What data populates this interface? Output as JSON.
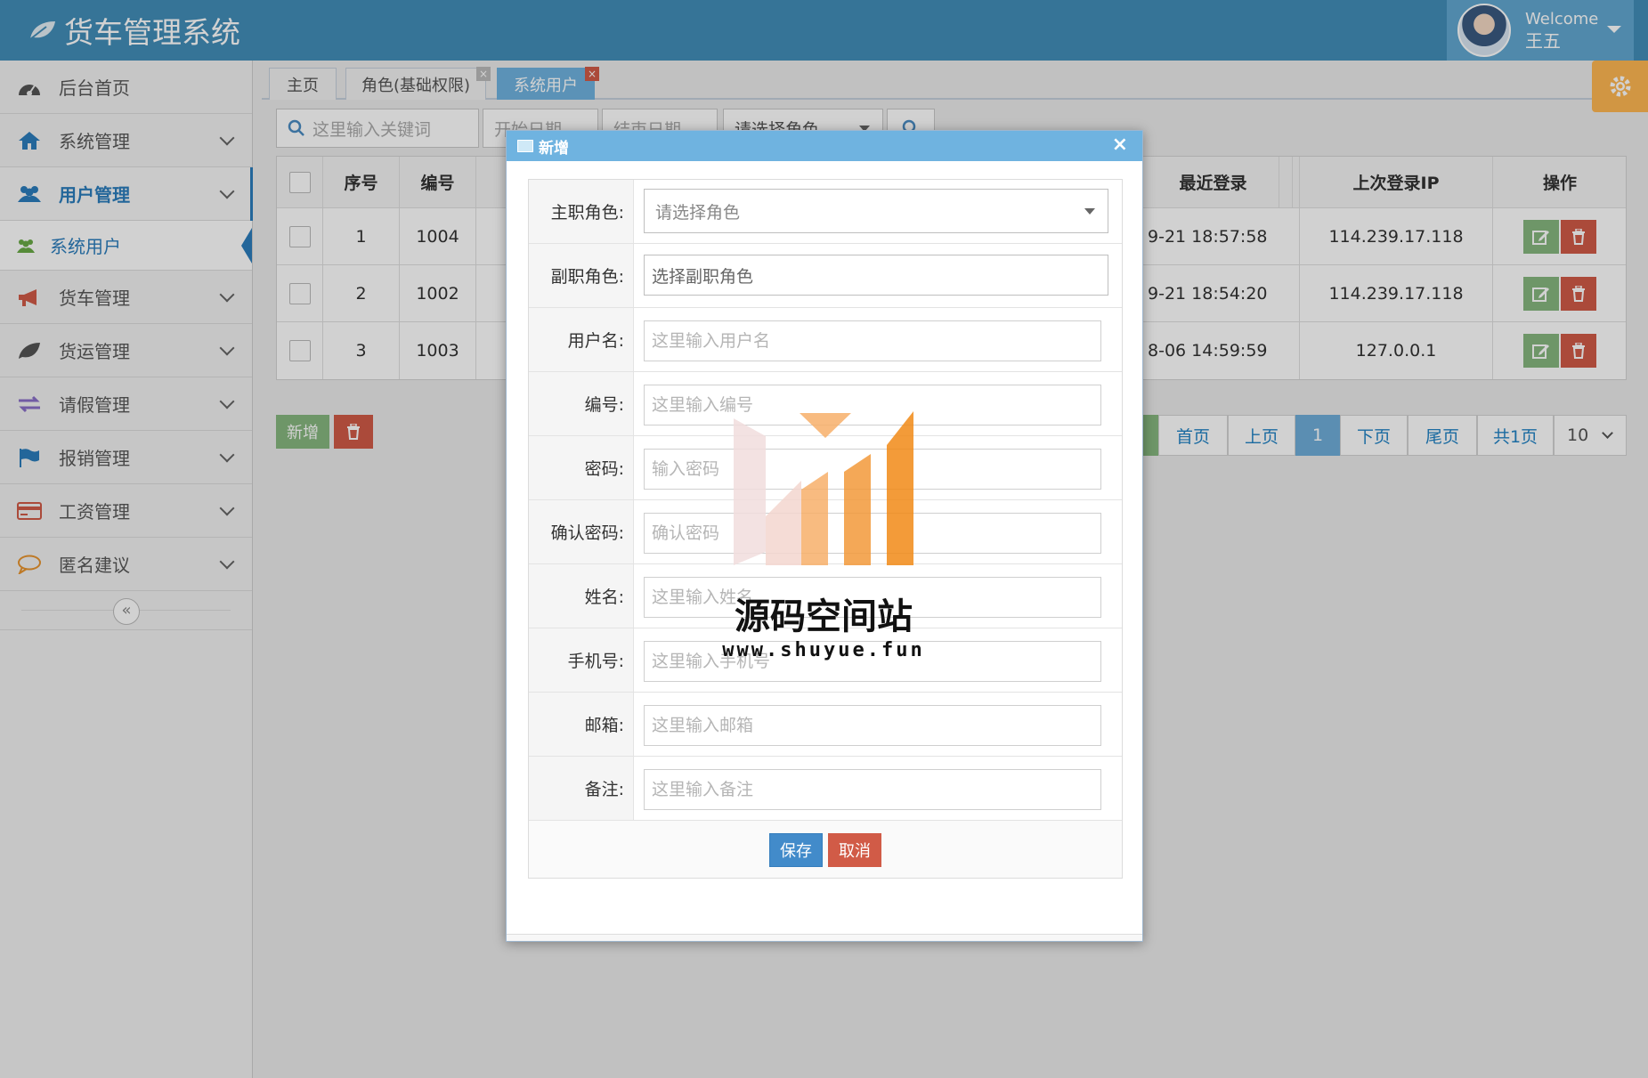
{
  "app": {
    "title": "货车管理系统"
  },
  "user": {
    "welcome": "Welcome",
    "name": "王五"
  },
  "sidebar": {
    "items": [
      {
        "label": "后台首页",
        "icon": "dashboard-icon"
      },
      {
        "label": "系统管理",
        "icon": "home-icon"
      },
      {
        "label": "用户管理",
        "icon": "users-icon",
        "active": true
      },
      {
        "label": "货车管理",
        "icon": "bullhorn-icon"
      },
      {
        "label": "货运管理",
        "icon": "leaf-icon"
      },
      {
        "label": "请假管理",
        "icon": "exchange-icon"
      },
      {
        "label": "报销管理",
        "icon": "flag-icon"
      },
      {
        "label": "工资管理",
        "icon": "credit-card-icon"
      },
      {
        "label": "匿名建议",
        "icon": "comment-icon"
      }
    ],
    "sub_item": "系统用户",
    "collapse": "«"
  },
  "tabs": [
    {
      "label": "主页"
    },
    {
      "label": "角色(基础权限)"
    },
    {
      "label": "系统用户",
      "active": true
    }
  ],
  "search": {
    "keyword_placeholder": "这里输入关键词",
    "start_date": "开始日期",
    "end_date": "结束日期",
    "role_select": "请选择角色"
  },
  "table": {
    "headers": {
      "seq": "序号",
      "code": "编号",
      "last_login": "最近登录",
      "last_ip": "上次登录IP",
      "actions": "操作"
    },
    "rows": [
      {
        "seq": "1",
        "code": "1004",
        "last_login": "9-21 18:57:58",
        "ip": "114.239.17.118"
      },
      {
        "seq": "2",
        "code": "1002",
        "last_login": "9-21 18:54:20",
        "ip": "114.239.17.118"
      },
      {
        "seq": "3",
        "code": "1003",
        "last_login": "8-06 14:59:59",
        "ip": "127.0.0.1"
      }
    ]
  },
  "toolbar": {
    "add_label": "新增"
  },
  "pager": {
    "first": "首页",
    "prev": "上页",
    "current": "1",
    "next": "下页",
    "last": "尾页",
    "total": "共1页",
    "page_size": "10"
  },
  "modal": {
    "title": "新增",
    "close": "×",
    "fields": {
      "primary_role_label": "主职角色:",
      "primary_role_value": "请选择角色",
      "secondary_role_label": "副职角色:",
      "secondary_role_value": "选择副职角色",
      "username_label": "用户名:",
      "username_placeholder": "这里输入用户名",
      "code_label": "编号:",
      "code_placeholder": "这里输入编号",
      "password_label": "密码:",
      "password_placeholder": "输入密码",
      "confirm_label": "确认密码:",
      "confirm_placeholder": "确认密码",
      "name_label": "姓名:",
      "name_placeholder": "这里输入姓名",
      "phone_label": "手机号:",
      "phone_placeholder": "这里输入手机号",
      "email_label": "邮箱:",
      "email_placeholder": "这里输入邮箱",
      "remark_label": "备注:",
      "remark_placeholder": "这里输入备注"
    },
    "save": "保存",
    "cancel": "取消"
  },
  "watermark": {
    "text": "源码空间站",
    "url": "www.shuyue.fun"
  },
  "colors": {
    "header": "#438eb9",
    "accent": "#2b7dbc",
    "green": "#87b87f",
    "red": "#d15b47",
    "orange": "#ffb752"
  }
}
